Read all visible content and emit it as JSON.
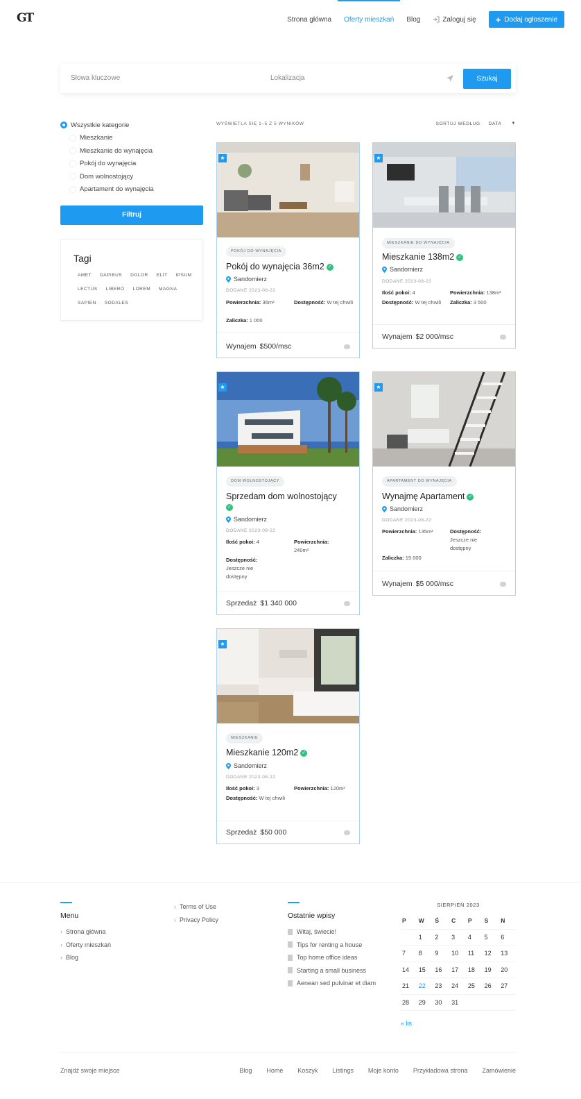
{
  "header": {
    "logo_text": "GT",
    "nav": [
      "Strona główna",
      "Oferty mieszkań",
      "Blog"
    ],
    "login": "Zaloguj się",
    "add_button": "Dodaj ogłoszenie"
  },
  "search": {
    "keywords_placeholder": "Słowa kluczowe",
    "location_placeholder": "Lokalizacja",
    "button": "Szukaj"
  },
  "categories": [
    "Wszystkie kategorie",
    "Mieszkanie",
    "Mieszkanie do wynajęcia",
    "Pokój do wynajęcia",
    "Dom wolnostojący",
    "Apartament do wynajęcia"
  ],
  "filter_button": "Filtruj",
  "tags": {
    "title": "Tagi",
    "items": [
      "AMET",
      "DAPIBUS",
      "DOLOR",
      "ELIT",
      "IPSUM",
      "LECTUS",
      "LIBERO",
      "LOREM",
      "MAGNA",
      "SAPIEN",
      "SODALES"
    ]
  },
  "results": {
    "info": "WYŚWIETLA SIĘ 1–5 Z 5 WYNIKÓW",
    "sort_label": "SORTUJ WEDŁUG",
    "sort_value": "DATA"
  },
  "listings": [
    {
      "badge": "POKÓJ DO WYNAJĘCIA",
      "title": "Pokój do wynajęcia 36m2",
      "place": "Sandomierz",
      "date": "DODANE 2023-08-22",
      "attrs": [
        {
          "label": "Powierzchnia:",
          "value": "36m²"
        },
        {
          "label": "Dostępność:",
          "value": "W tej chwili"
        },
        {
          "label": "Zaliczka:",
          "value": "1 000"
        }
      ],
      "price_label": "Wynajem",
      "price": "$500/msc"
    },
    {
      "badge": "MIESZKANIE DO WYNAJĘCIA",
      "title": "Mieszkanie 138m2",
      "place": "Sandomierz",
      "date": "DODANE 2023-08-22",
      "attrs": [
        {
          "label": "Ilość pokoi:",
          "value": "4"
        },
        {
          "label": "Powierzchnia:",
          "value": "138m²"
        },
        {
          "label": "Dostępność:",
          "value": "W tej chwili"
        },
        {
          "label": "Zaliczka:",
          "value": "3 500"
        }
      ],
      "price_label": "Wynajem",
      "price": "$2 000/msc"
    },
    {
      "badge": "DOM WOLNOSTOJĄCY",
      "title": "Sprzedam dom wolnostojący",
      "place": "Sandomierz",
      "date": "DODANE 2023-08-22",
      "attrs": [
        {
          "label": "Ilość pokoi:",
          "value": "4"
        },
        {
          "label": "Powierzchnia:",
          "value": "240m²"
        },
        {
          "label": "Dostępność:",
          "value": "Jeszcze nie dostępny"
        }
      ],
      "price_label": "Sprzedaż",
      "price": "$1 340 000"
    },
    {
      "badge": "APARTAMENT DO WYNAJĘCIA",
      "title": "Wynajmę Apartament",
      "place": "Sandomierz",
      "date": "DODANE 2023-08-22",
      "attrs": [
        {
          "label": "Powierzchnia:",
          "value": "135m²"
        },
        {
          "label": "Dostępność:",
          "value": "Jeszcze nie dostępny"
        },
        {
          "label": "Zaliczka:",
          "value": "15 000"
        }
      ],
      "price_label": "Wynajem",
      "price": "$5 000/msc"
    },
    {
      "badge": "MIESZKANIE",
      "title": "Mieszkanie 120m2",
      "place": "Sandomierz",
      "date": "DODANE 2023-08-22",
      "attrs": [
        {
          "label": "Ilość pokoi:",
          "value": "3"
        },
        {
          "label": "Powierzchnia:",
          "value": "120m²"
        },
        {
          "label": "Dostępność:",
          "value": "W tej chwili"
        }
      ],
      "price_label": "Sprzedaż",
      "price": "$50 000"
    }
  ],
  "footer": {
    "menu_title": "Menu",
    "menu_links": [
      "Strona główna",
      "Oferty mieszkań",
      "Blog"
    ],
    "policy_links": [
      "Terms of Use",
      "Privacy Policy"
    ],
    "recent_title": "Ostatnie wpisy",
    "recent_posts": [
      "Witaj, świecie!",
      "Tips for renting a house",
      "Top home office ideas",
      "Starting a small business",
      "Aenean sed pulvinar et diam"
    ],
    "calendar": {
      "title": "SIERPIEŃ 2023",
      "day_headers": [
        "P",
        "W",
        "Ś",
        "C",
        "P",
        "S",
        "N"
      ],
      "cells": [
        "",
        "1",
        "2",
        "3",
        "4",
        "5",
        "6",
        "7",
        "8",
        "9",
        "10",
        "11",
        "12",
        "13",
        "14",
        "15",
        "16",
        "17",
        "18",
        "19",
        "20",
        "21",
        "22",
        "23",
        "24",
        "25",
        "26",
        "27",
        "28",
        "29",
        "30",
        "31",
        "",
        "",
        ""
      ],
      "today": "22",
      "prev": "« lis"
    },
    "tagline": "Znajdź swoje miejsce",
    "bottom_links": [
      "Blog",
      "Home",
      "Koszyk",
      "Listings",
      "Moje konto",
      "Przykładowa strona",
      "Zamówienie"
    ]
  }
}
